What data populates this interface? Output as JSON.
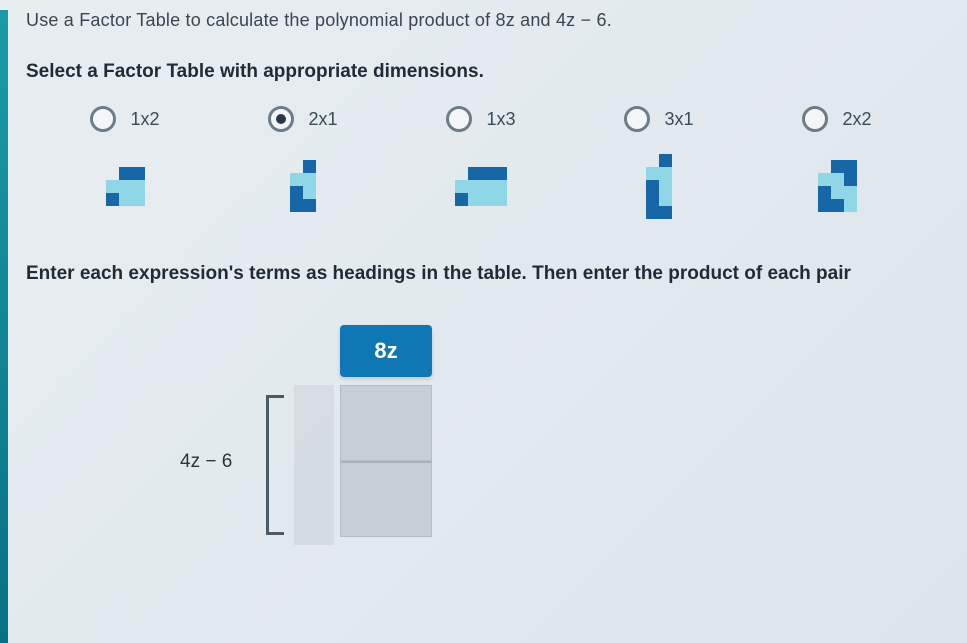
{
  "question": "Use a Factor Table to calculate the polynomial product of 8z and 4z − 6.",
  "subhead": "Select a Factor Table with appropriate dimensions.",
  "options": [
    {
      "label": "1x2",
      "selected": false
    },
    {
      "label": "2x1",
      "selected": true
    },
    {
      "label": "1x3",
      "selected": false
    },
    {
      "label": "3x1",
      "selected": false
    },
    {
      "label": "2x2",
      "selected": false
    }
  ],
  "instruction": "Enter each expression's terms as headings in the table. Then enter the product of each pair",
  "factor_table": {
    "col_header": "8z",
    "row_label": "4z − 6",
    "cells": [
      "",
      ""
    ]
  }
}
